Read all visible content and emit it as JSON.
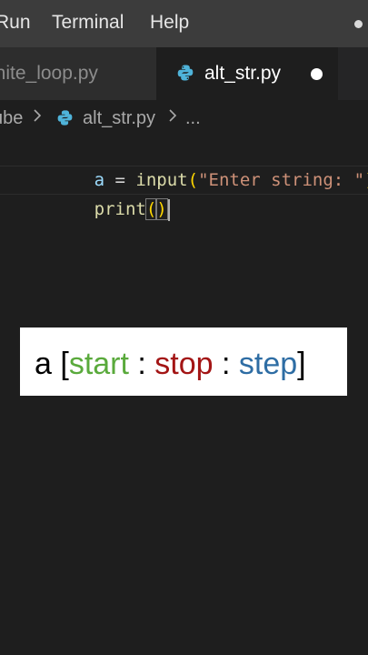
{
  "menubar": {
    "items": [
      "Run",
      "Terminal",
      "Help"
    ]
  },
  "tabs": [
    {
      "label": "inite_loop.py",
      "active": false,
      "modified": false
    },
    {
      "label": "alt_str.py",
      "active": true,
      "modified": true
    }
  ],
  "breadcrumb": {
    "folder": "ube",
    "file": "alt_str.py",
    "more": "..."
  },
  "editor": {
    "lines": [
      {
        "tokens": [
          {
            "text": "a",
            "kind": "var"
          },
          {
            "text": " = ",
            "kind": "op"
          },
          {
            "text": "input",
            "kind": "fn"
          },
          {
            "text": "(",
            "kind": "paren"
          },
          {
            "text": "\"Enter string: \"",
            "kind": "str"
          },
          {
            "text": ")",
            "kind": "paren"
          }
        ]
      },
      {
        "tokens": [
          {
            "text": "print",
            "kind": "fn"
          },
          {
            "text": "(",
            "kind": "paren"
          },
          {
            "text": ")",
            "kind": "paren"
          }
        ]
      }
    ]
  },
  "overlay": {
    "prefix": "a [",
    "start": "start",
    "sep1": " : ",
    "stop": "stop",
    "sep2": " : ",
    "step": "step",
    "suffix": "]"
  },
  "colors": {
    "start": "#5aaa3c",
    "stop": "#a31515",
    "step": "#2e6da4",
    "python_icon": "#4fb3d9"
  }
}
